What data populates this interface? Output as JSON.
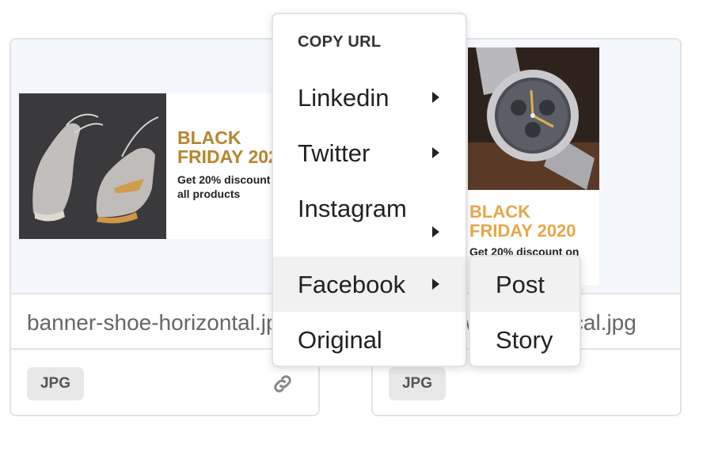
{
  "cards": [
    {
      "filename": "banner-shoe-horizontal.jpg",
      "badge": "JPG",
      "banner": {
        "title_line1": "BLACK",
        "title_line2": "FRIDAY 2020",
        "sub_line1": "Get 20% discount on",
        "sub_line2": "all products"
      }
    },
    {
      "filename": "banner-watch-vertical.jpg",
      "badge": "JPG",
      "banner": {
        "title_line1": "BLACK",
        "title_line2": "FRIDAY 2020",
        "sub_line1": "Get 20% discount on"
      }
    }
  ],
  "menu": {
    "header": "COPY URL",
    "items": [
      {
        "label": "Linkedin",
        "has_submenu": true
      },
      {
        "label": "Twitter",
        "has_submenu": true
      },
      {
        "label": "Instagram",
        "has_submenu": true
      },
      {
        "label": "Facebook",
        "has_submenu": true,
        "active": true
      },
      {
        "label": "Original",
        "has_submenu": false
      }
    ]
  },
  "submenu": {
    "items": [
      {
        "label": "Post",
        "active": true
      },
      {
        "label": "Story"
      }
    ]
  },
  "icons": {
    "link": "link-icon",
    "arrow": "caret-right-icon"
  },
  "colors": {
    "accent_gold": "#b8842c",
    "accent_orange": "#e7a64a",
    "hover_bg": "#f1f1f1"
  }
}
